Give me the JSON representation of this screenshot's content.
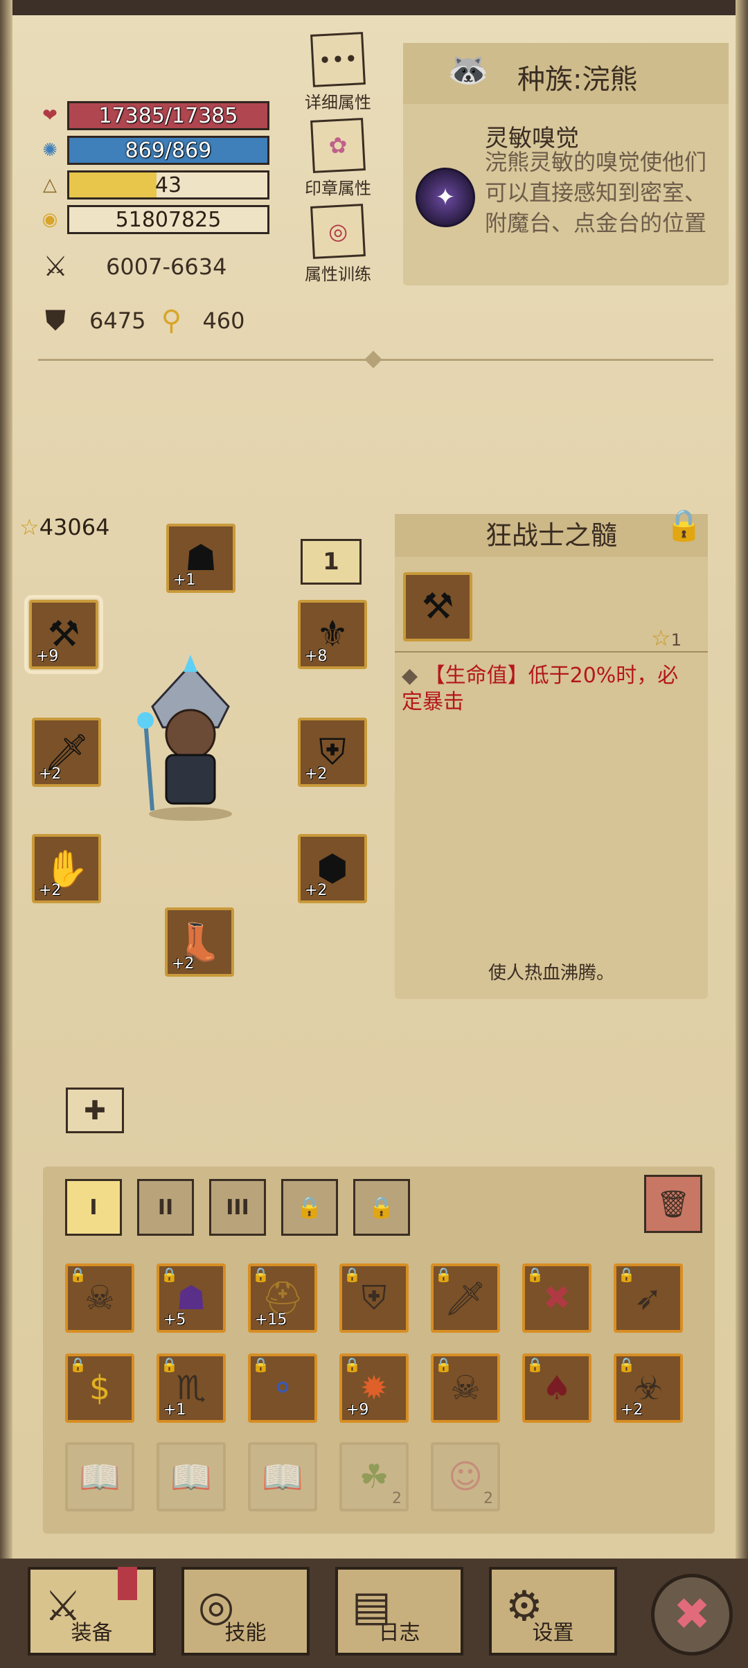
{
  "stats": {
    "hp": "17385/17385",
    "mp": "869/869",
    "level": "43",
    "gold": "51807825",
    "attack": "6007-6634",
    "defense": "6475",
    "crit": "460",
    "hp_fraction": 1.0,
    "mp_fraction": 1.0,
    "level_fraction": 0.44
  },
  "side_buttons": {
    "detail": "详细属性",
    "seal": "印章属性",
    "train": "属性训练"
  },
  "race": {
    "title": "种族:浣熊",
    "skill_name": "灵敏嗅觉",
    "skill_desc": "浣熊灵敏的嗅觉使他们可以直接感知到密室、附魔台、点金台的位置"
  },
  "equipment": {
    "score": "43064",
    "tier": "1",
    "helmet": "+1",
    "weapon": "+9",
    "ring": "+8",
    "offhand": "+2",
    "armor": "+2",
    "gloves": "+2",
    "belt": "+2",
    "boots": "+2"
  },
  "item": {
    "name": "狂战士之髓",
    "stars": "1",
    "effect": "【生命值】低于20%时，必定暴击",
    "flavor": "使人热血沸腾。"
  },
  "inventory": {
    "tabs": [
      "I",
      "II",
      "III",
      "🔒",
      "🔒"
    ],
    "row1_levels": [
      "",
      "+5",
      "+15",
      "",
      "",
      "",
      ""
    ],
    "row2_levels": [
      "",
      "+1",
      "",
      "+9",
      "",
      "",
      "+2"
    ],
    "row3_counts": [
      "",
      "",
      "",
      "2",
      "2"
    ]
  },
  "nav": {
    "equip": "装备",
    "skills": "技能",
    "log": "日志",
    "settings": "设置"
  },
  "colors": {
    "hp": "#b0464f",
    "mp": "#3f7fba",
    "level": "#e8c54b",
    "effect_text": "#b4171c"
  }
}
